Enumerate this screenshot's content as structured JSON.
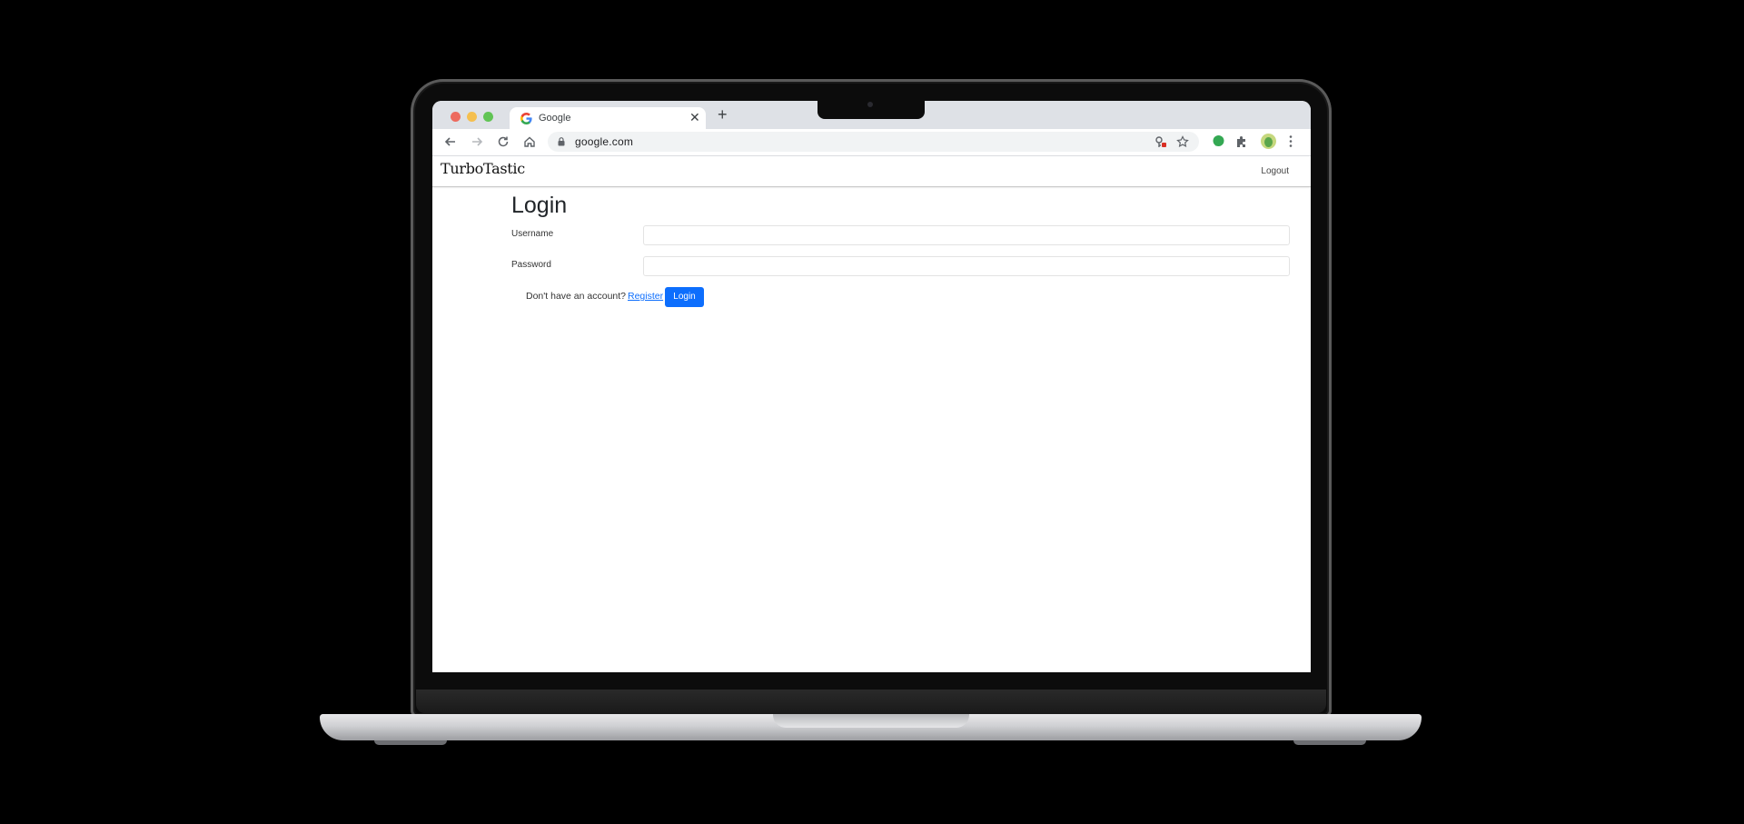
{
  "browser": {
    "tab_title": "Google",
    "new_tab_symbol": "+",
    "close_symbol": "✕",
    "url": "google.com",
    "icons": [
      "back-icon",
      "forward-icon",
      "reload-icon",
      "home-icon",
      "lock-icon",
      "key-icon",
      "star-icon",
      "extension-icon",
      "puzzle-icon",
      "profile-avatar",
      "menu-icon"
    ]
  },
  "site": {
    "brand": "TurboTastic",
    "logout": "Logout"
  },
  "form": {
    "title": "Login",
    "username_label": "Username",
    "username_value": "",
    "password_label": "Password",
    "password_value": "",
    "no_account_text": "Don't have an account?",
    "register_link": "Register",
    "login_button": "Login"
  },
  "colors": {
    "primary": "#0d6efd",
    "tabbar": "#dee1e6"
  }
}
